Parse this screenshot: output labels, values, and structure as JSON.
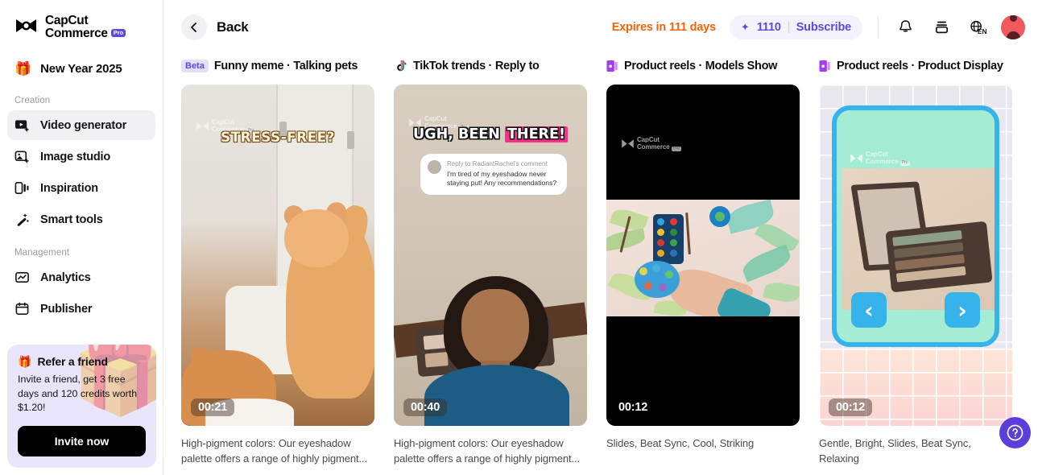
{
  "brand": {
    "line1": "CapCut",
    "line2": "Commerce",
    "badge": "Pro"
  },
  "sidebar": {
    "promo": {
      "icon": "gift-icon",
      "label": "New Year 2025"
    },
    "sections": [
      {
        "label": "Creation",
        "items": [
          {
            "label": "Video generator",
            "icon": "video-generator-icon",
            "active": true
          },
          {
            "label": "Image studio",
            "icon": "image-studio-icon",
            "active": false
          },
          {
            "label": "Inspiration",
            "icon": "inspiration-icon",
            "active": false
          },
          {
            "label": "Smart tools",
            "icon": "magic-wand-icon",
            "active": false
          }
        ]
      },
      {
        "label": "Management",
        "items": [
          {
            "label": "Analytics",
            "icon": "analytics-icon",
            "active": false
          },
          {
            "label": "Publisher",
            "icon": "publisher-icon",
            "active": false
          }
        ]
      }
    ],
    "refer": {
      "title": "Refer a friend",
      "body": "Invite a friend, get 3 free days and 120 credits worth $1.20!",
      "button": "Invite now"
    }
  },
  "topbar": {
    "back_label": "Back",
    "expires": "Expires in 111 days",
    "credits": "1110",
    "subscribe": "Subscribe",
    "icons": [
      "bell-icon",
      "inbox-icon",
      "language-icon"
    ],
    "language": "EN"
  },
  "cards": [
    {
      "badge": "Beta",
      "icon": null,
      "title": "Funny meme · Talking pets",
      "duration": "00:21",
      "caption": "High-pigment colors: Our eyeshadow palette offers a range of highly pigment...",
      "overlay_text": "STRESS-FREE?",
      "watermark": "CapCut Commerce Pro"
    },
    {
      "badge": null,
      "icon": "tiktok-icon",
      "title": "TikTok trends · Reply to",
      "duration": "00:40",
      "caption": "High-pigment colors: Our eyeshadow palette offers a range of highly pigment...",
      "overlay_text_plain": "UGH, BEEN ",
      "overlay_text_highlight": "THERE!",
      "comment_header": "Reply to RadiantRachel's comment",
      "comment_body": "I'm tired of my eyeshadow never staying put! Any recommendations?",
      "watermark": "CapCut Commerce Pro"
    },
    {
      "badge": null,
      "icon": "product-reels-icon",
      "title": "Product reels · Models Show",
      "duration": "00:12",
      "caption": "Slides, Beat Sync, Cool, Striking",
      "watermark": "CapCut Commerce Pro"
    },
    {
      "badge": null,
      "icon": "product-reels-icon",
      "title": "Product reels · Product Display",
      "duration": "00:12",
      "caption": "Gentle, Bright, Slides, Beat Sync, Relaxing",
      "prev_arrow": "‹",
      "next_arrow": "›",
      "watermark": "CapCut Commerce Pro"
    }
  ],
  "help": {
    "icon": "help-icon"
  },
  "colors": {
    "accent": "#5b4ae0",
    "warning": "#f2630a",
    "frame": "#35b3ea",
    "mint": "#a5ecd4",
    "help": "#5b3fdb"
  }
}
